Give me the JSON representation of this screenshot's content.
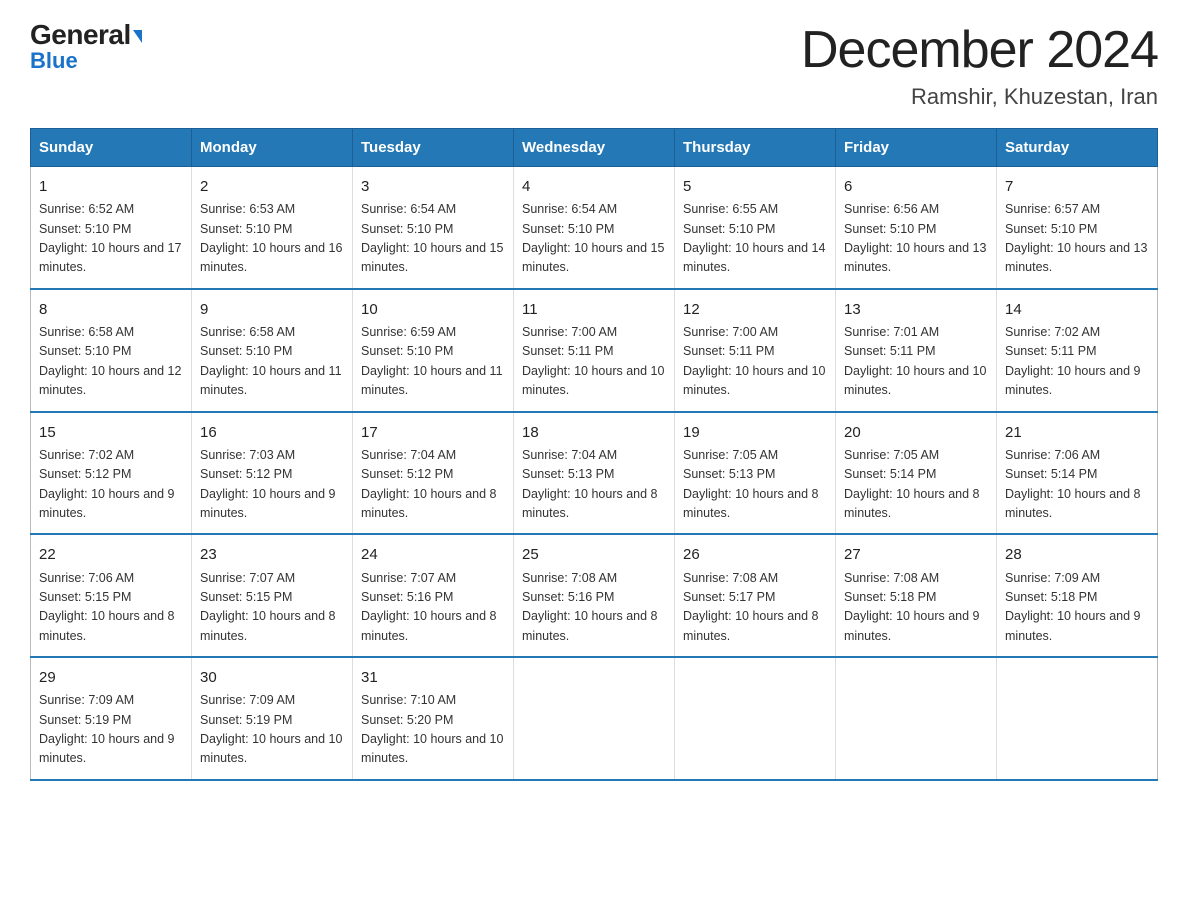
{
  "logo": {
    "general": "General",
    "blue": "Blue",
    "triangle": "▶"
  },
  "title": "December 2024",
  "subtitle": "Ramshir, Khuzestan, Iran",
  "days_of_week": [
    "Sunday",
    "Monday",
    "Tuesday",
    "Wednesday",
    "Thursday",
    "Friday",
    "Saturday"
  ],
  "weeks": [
    [
      {
        "day": "1",
        "sunrise": "6:52 AM",
        "sunset": "5:10 PM",
        "daylight": "10 hours and 17 minutes."
      },
      {
        "day": "2",
        "sunrise": "6:53 AM",
        "sunset": "5:10 PM",
        "daylight": "10 hours and 16 minutes."
      },
      {
        "day": "3",
        "sunrise": "6:54 AM",
        "sunset": "5:10 PM",
        "daylight": "10 hours and 15 minutes."
      },
      {
        "day": "4",
        "sunrise": "6:54 AM",
        "sunset": "5:10 PM",
        "daylight": "10 hours and 15 minutes."
      },
      {
        "day": "5",
        "sunrise": "6:55 AM",
        "sunset": "5:10 PM",
        "daylight": "10 hours and 14 minutes."
      },
      {
        "day": "6",
        "sunrise": "6:56 AM",
        "sunset": "5:10 PM",
        "daylight": "10 hours and 13 minutes."
      },
      {
        "day": "7",
        "sunrise": "6:57 AM",
        "sunset": "5:10 PM",
        "daylight": "10 hours and 13 minutes."
      }
    ],
    [
      {
        "day": "8",
        "sunrise": "6:58 AM",
        "sunset": "5:10 PM",
        "daylight": "10 hours and 12 minutes."
      },
      {
        "day": "9",
        "sunrise": "6:58 AM",
        "sunset": "5:10 PM",
        "daylight": "10 hours and 11 minutes."
      },
      {
        "day": "10",
        "sunrise": "6:59 AM",
        "sunset": "5:10 PM",
        "daylight": "10 hours and 11 minutes."
      },
      {
        "day": "11",
        "sunrise": "7:00 AM",
        "sunset": "5:11 PM",
        "daylight": "10 hours and 10 minutes."
      },
      {
        "day": "12",
        "sunrise": "7:00 AM",
        "sunset": "5:11 PM",
        "daylight": "10 hours and 10 minutes."
      },
      {
        "day": "13",
        "sunrise": "7:01 AM",
        "sunset": "5:11 PM",
        "daylight": "10 hours and 10 minutes."
      },
      {
        "day": "14",
        "sunrise": "7:02 AM",
        "sunset": "5:11 PM",
        "daylight": "10 hours and 9 minutes."
      }
    ],
    [
      {
        "day": "15",
        "sunrise": "7:02 AM",
        "sunset": "5:12 PM",
        "daylight": "10 hours and 9 minutes."
      },
      {
        "day": "16",
        "sunrise": "7:03 AM",
        "sunset": "5:12 PM",
        "daylight": "10 hours and 9 minutes."
      },
      {
        "day": "17",
        "sunrise": "7:04 AM",
        "sunset": "5:12 PM",
        "daylight": "10 hours and 8 minutes."
      },
      {
        "day": "18",
        "sunrise": "7:04 AM",
        "sunset": "5:13 PM",
        "daylight": "10 hours and 8 minutes."
      },
      {
        "day": "19",
        "sunrise": "7:05 AM",
        "sunset": "5:13 PM",
        "daylight": "10 hours and 8 minutes."
      },
      {
        "day": "20",
        "sunrise": "7:05 AM",
        "sunset": "5:14 PM",
        "daylight": "10 hours and 8 minutes."
      },
      {
        "day": "21",
        "sunrise": "7:06 AM",
        "sunset": "5:14 PM",
        "daylight": "10 hours and 8 minutes."
      }
    ],
    [
      {
        "day": "22",
        "sunrise": "7:06 AM",
        "sunset": "5:15 PM",
        "daylight": "10 hours and 8 minutes."
      },
      {
        "day": "23",
        "sunrise": "7:07 AM",
        "sunset": "5:15 PM",
        "daylight": "10 hours and 8 minutes."
      },
      {
        "day": "24",
        "sunrise": "7:07 AM",
        "sunset": "5:16 PM",
        "daylight": "10 hours and 8 minutes."
      },
      {
        "day": "25",
        "sunrise": "7:08 AM",
        "sunset": "5:16 PM",
        "daylight": "10 hours and 8 minutes."
      },
      {
        "day": "26",
        "sunrise": "7:08 AM",
        "sunset": "5:17 PM",
        "daylight": "10 hours and 8 minutes."
      },
      {
        "day": "27",
        "sunrise": "7:08 AM",
        "sunset": "5:18 PM",
        "daylight": "10 hours and 9 minutes."
      },
      {
        "day": "28",
        "sunrise": "7:09 AM",
        "sunset": "5:18 PM",
        "daylight": "10 hours and 9 minutes."
      }
    ],
    [
      {
        "day": "29",
        "sunrise": "7:09 AM",
        "sunset": "5:19 PM",
        "daylight": "10 hours and 9 minutes."
      },
      {
        "day": "30",
        "sunrise": "7:09 AM",
        "sunset": "5:19 PM",
        "daylight": "10 hours and 10 minutes."
      },
      {
        "day": "31",
        "sunrise": "7:10 AM",
        "sunset": "5:20 PM",
        "daylight": "10 hours and 10 minutes."
      },
      null,
      null,
      null,
      null
    ]
  ]
}
